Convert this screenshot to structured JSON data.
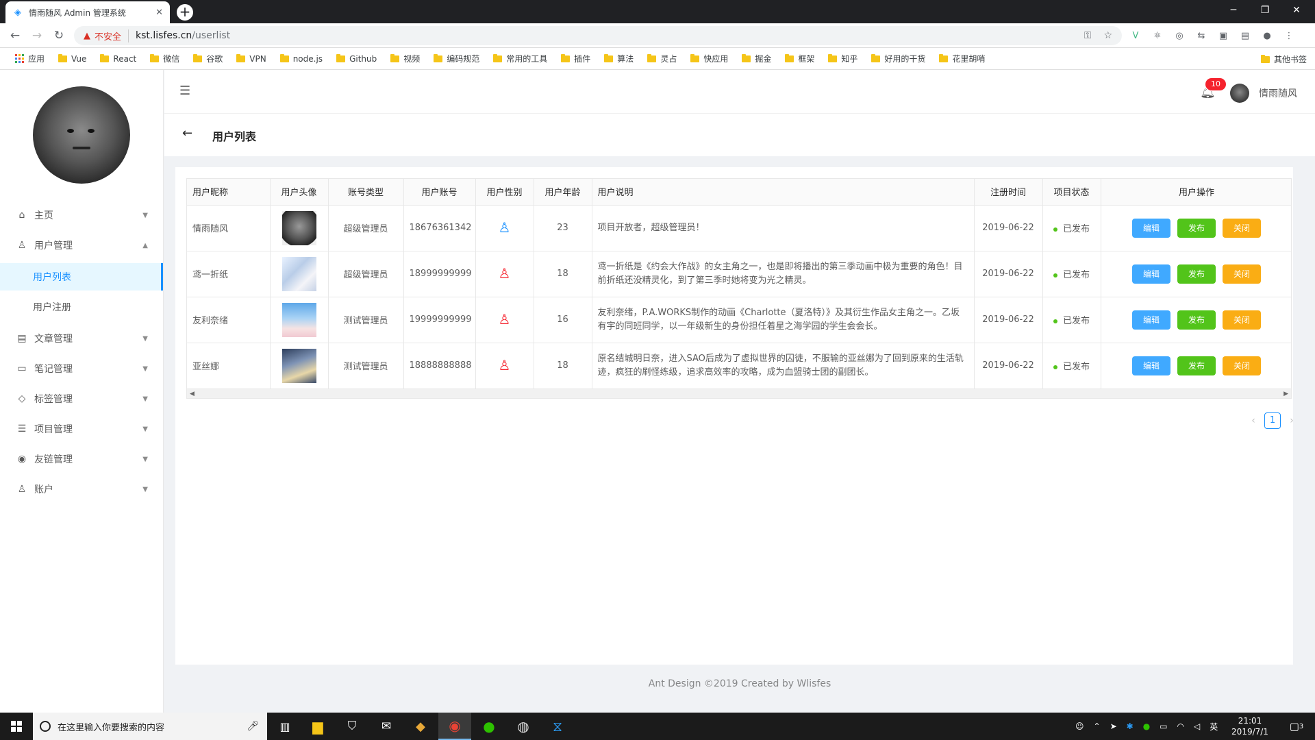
{
  "browser": {
    "tab_title": "情雨随风 Admin 管理系统",
    "insecure_label": "不安全",
    "url_host": "kst.lisfes.cn",
    "url_path": "/userlist",
    "bookmarks": [
      "Vue",
      "React",
      "微信",
      "谷歌",
      "VPN",
      "node.js",
      "Github",
      "视频",
      "编码规范",
      "常用的工具",
      "插件",
      "算法",
      "灵占",
      "快应用",
      "掘金",
      "框架",
      "知乎",
      "好用的干货",
      "花里胡哨"
    ],
    "apps_label": "应用",
    "other_bookmarks": "其他书签"
  },
  "sidebar": {
    "items": [
      {
        "label": "主页",
        "icon": "home-icon"
      },
      {
        "label": "用户管理",
        "icon": "user-icon"
      },
      {
        "label": "文章管理",
        "icon": "article-icon"
      },
      {
        "label": "笔记管理",
        "icon": "note-icon"
      },
      {
        "label": "标签管理",
        "icon": "tag-icon"
      },
      {
        "label": "项目管理",
        "icon": "project-icon"
      },
      {
        "label": "友链管理",
        "icon": "github-icon"
      },
      {
        "label": "账户",
        "icon": "account-icon"
      }
    ],
    "sub_items": [
      {
        "label": "用户列表",
        "active": true
      },
      {
        "label": "用户注册",
        "active": false
      }
    ]
  },
  "header": {
    "notification_count": "10",
    "username": "情雨随风"
  },
  "page": {
    "title": "用户列表"
  },
  "table": {
    "columns": [
      "用户昵称",
      "用户头像",
      "账号类型",
      "用户账号",
      "用户性别",
      "用户年龄",
      "用户说明",
      "注册时间",
      "项目状态",
      "用户操作"
    ],
    "rows": [
      {
        "nickname": "情雨随风",
        "type": "超级管理员",
        "account": "18676361342",
        "gender": "male",
        "age": "23",
        "desc": "项目开放者，超级管理员！",
        "date": "2019-06-22",
        "status": "已发布"
      },
      {
        "nickname": "鸢一折纸",
        "type": "超级管理员",
        "account": "18999999999",
        "gender": "female",
        "age": "18",
        "desc": "鸢一折纸是《约会大作战》的女主角之一，也是即将播出的第三季动画中极为重要的角色！目前折纸还没精灵化，到了第三季时她将变为光之精灵。",
        "date": "2019-06-22",
        "status": "已发布"
      },
      {
        "nickname": "友利奈绪",
        "type": "测试管理员",
        "account": "19999999999",
        "gender": "female",
        "age": "16",
        "desc": "友利奈绪，P.A.WORKS制作的动画《Charlotte（夏洛特）》及其衍生作品女主角之一。乙坂有宇的同班同学，以一年级新生的身份担任着星之海学园的学生会会长。",
        "date": "2019-06-22",
        "status": "已发布"
      },
      {
        "nickname": "亚丝娜",
        "type": "测试管理员",
        "account": "18888888888",
        "gender": "female",
        "age": "18",
        "desc": "原名结城明日奈，进入SAO后成为了虚拟世界的囚徒，不服输的亚丝娜为了回到原来的生活轨迹，疯狂的刷怪练级，追求高效率的攻略，成为血盟骑士团的副团长。",
        "date": "2019-06-22",
        "status": "已发布"
      }
    ],
    "actions": {
      "edit": "编辑",
      "publish": "发布",
      "close": "关闭"
    }
  },
  "pagination": {
    "current": "1"
  },
  "footer": {
    "text": "Ant Design ©2019 Created by Wlisfes"
  },
  "taskbar": {
    "search_placeholder": "在这里输入你要搜索的内容",
    "time": "21:01",
    "date": "2019/7/1",
    "ime": "英",
    "notifications": "3"
  },
  "colors": {
    "primary": "#1890ff",
    "edit_btn": "#40a9ff",
    "publish_btn": "#52c41a",
    "close_btn": "#faad14",
    "status_dot": "#52c41a",
    "badge": "#f5222d",
    "male": "#1890ff",
    "female": "#f5222d"
  }
}
